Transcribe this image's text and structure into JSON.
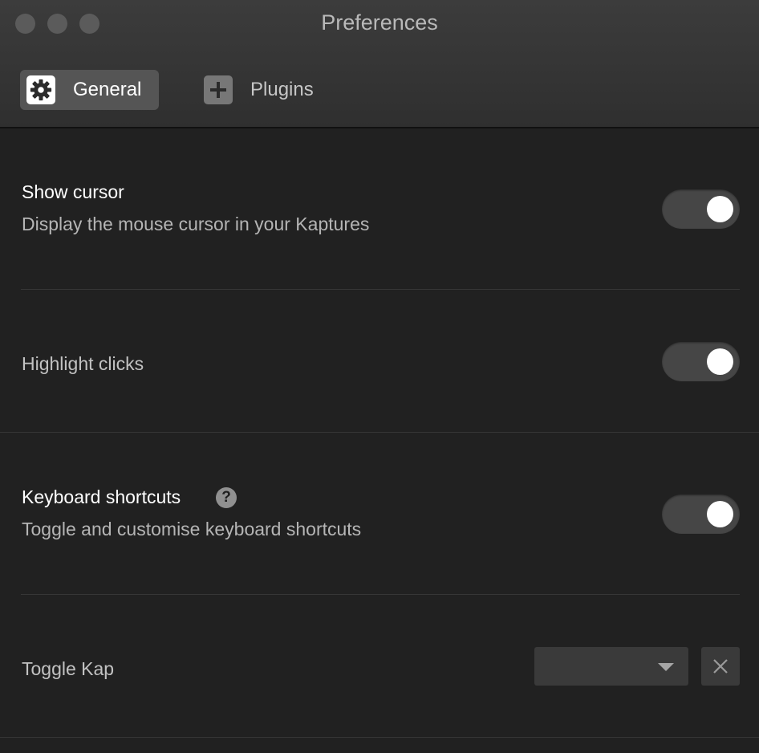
{
  "window": {
    "title": "Preferences"
  },
  "tabs": [
    {
      "label": "General",
      "icon": "gear-icon",
      "active": true
    },
    {
      "label": "Plugins",
      "icon": "plus-icon",
      "active": false
    }
  ],
  "settings": {
    "show_cursor": {
      "title": "Show cursor",
      "description": "Display the mouse cursor in your Kaptures",
      "enabled": true
    },
    "highlight_clicks": {
      "title": "Highlight clicks",
      "enabled": true
    },
    "keyboard_shortcuts": {
      "title": "Keyboard shortcuts",
      "description": "Toggle and customise keyboard shortcuts",
      "enabled": true,
      "help_icon": "question-mark-icon"
    },
    "toggle_kap": {
      "title": "Toggle Kap",
      "shortcut_value": "",
      "clear_icon": "close-icon"
    }
  },
  "colors": {
    "background": "#212121",
    "titlebar": "#333333",
    "toggle_track": "#464646",
    "toggle_knob": "#ffffff",
    "active_tab": "#555555"
  }
}
